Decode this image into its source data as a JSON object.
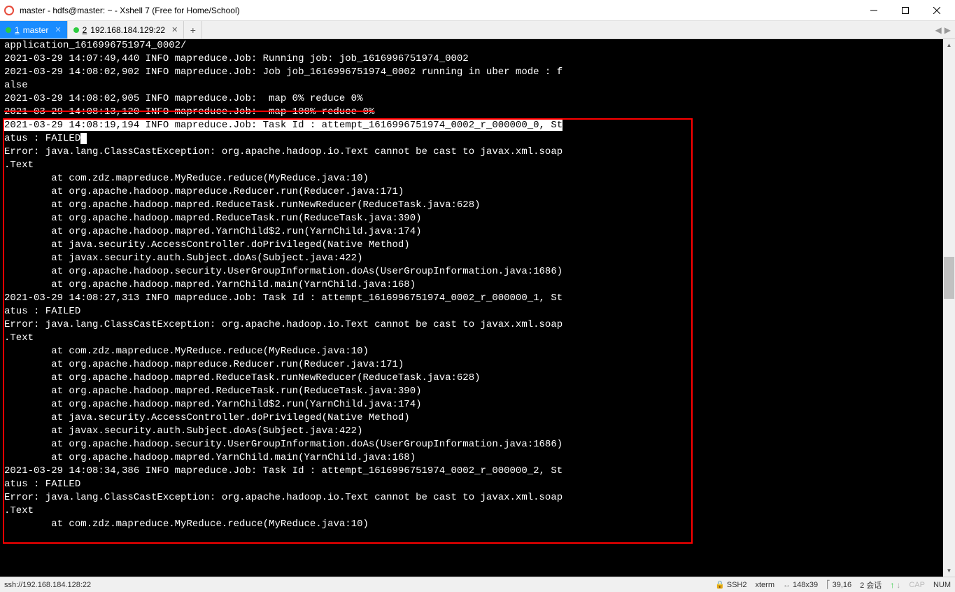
{
  "window": {
    "title": "master - hdfs@master: ~ - Xshell 7 (Free for Home/School)"
  },
  "tabs": {
    "active": {
      "index": "1",
      "label": "master"
    },
    "second": {
      "index": "2",
      "label": "192.168.184.129:22"
    },
    "add": "+"
  },
  "terminal": {
    "lines": [
      "application_1616996751974_0002/",
      "2021-03-29 14:07:49,440 INFO mapreduce.Job: Running job: job_1616996751974_0002",
      "2021-03-29 14:08:02,902 INFO mapreduce.Job: Job job_1616996751974_0002 running in uber mode : f",
      "alse",
      "2021-03-29 14:08:02,905 INFO mapreduce.Job:  map 0% reduce 0%",
      "2021-03-29 14:08:13,120 INFO mapreduce.Job:  map 100% reduce 0%"
    ],
    "hl_a": "2021-03-29 14:08:19,194 INFO mapreduce.Job: Task Id : attempt_1616996751974_0002_r_000000_0, St",
    "block1": [
      "atus : FAILED",
      "Error: java.lang.ClassCastException: org.apache.hadoop.io.Text cannot be cast to javax.xml.soap",
      ".Text",
      "        at com.zdz.mapreduce.MyReduce.reduce(MyReduce.java:10)",
      "        at org.apache.hadoop.mapreduce.Reducer.run(Reducer.java:171)",
      "        at org.apache.hadoop.mapred.ReduceTask.runNewReducer(ReduceTask.java:628)",
      "        at org.apache.hadoop.mapred.ReduceTask.run(ReduceTask.java:390)",
      "        at org.apache.hadoop.mapred.YarnChild$2.run(YarnChild.java:174)",
      "        at java.security.AccessController.doPrivileged(Native Method)",
      "        at javax.security.auth.Subject.doAs(Subject.java:422)",
      "        at org.apache.hadoop.security.UserGroupInformation.doAs(UserGroupInformation.java:1686)",
      "        at org.apache.hadoop.mapred.YarnChild.main(YarnChild.java:168)",
      "",
      "2021-03-29 14:08:27,313 INFO mapreduce.Job: Task Id : attempt_1616996751974_0002_r_000000_1, St",
      "atus : FAILED",
      "Error: java.lang.ClassCastException: org.apache.hadoop.io.Text cannot be cast to javax.xml.soap",
      ".Text",
      "        at com.zdz.mapreduce.MyReduce.reduce(MyReduce.java:10)",
      "        at org.apache.hadoop.mapreduce.Reducer.run(Reducer.java:171)",
      "        at org.apache.hadoop.mapred.ReduceTask.runNewReducer(ReduceTask.java:628)",
      "        at org.apache.hadoop.mapred.ReduceTask.run(ReduceTask.java:390)",
      "        at org.apache.hadoop.mapred.YarnChild$2.run(YarnChild.java:174)",
      "        at java.security.AccessController.doPrivileged(Native Method)",
      "        at javax.security.auth.Subject.doAs(Subject.java:422)",
      "        at org.apache.hadoop.security.UserGroupInformation.doAs(UserGroupInformation.java:1686)",
      "        at org.apache.hadoop.mapred.YarnChild.main(YarnChild.java:168)",
      "",
      "2021-03-29 14:08:34,386 INFO mapreduce.Job: Task Id : attempt_1616996751974_0002_r_000000_2, St",
      "atus : FAILED",
      "Error: java.lang.ClassCastException: org.apache.hadoop.io.Text cannot be cast to javax.xml.soap",
      ".Text",
      "        at com.zdz.mapreduce.MyReduce.reduce(MyReduce.java:10)"
    ]
  },
  "status": {
    "ssh": "ssh://192.168.184.128:22",
    "ssh_label": "SSH2",
    "term": "xterm",
    "size": "148x39",
    "cursor": "39,16",
    "sessions": "2 会话",
    "cap": "CAP",
    "num": "NUM"
  }
}
